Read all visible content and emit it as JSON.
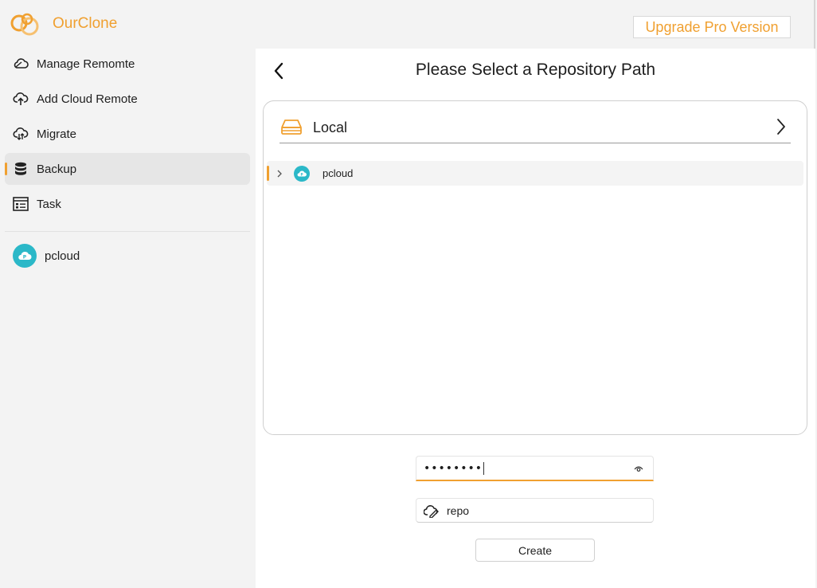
{
  "app": {
    "title": "OurClone",
    "upgrade_label": "Upgrade Pro Version",
    "accent_color": "#f0a030",
    "remote_color": "#2bb8c8"
  },
  "sidebar": {
    "items": [
      {
        "label": "Manage Remomte",
        "icon": "cloud-outline-icon",
        "active": false
      },
      {
        "label": "Add Cloud Remote",
        "icon": "cloud-upload-icon",
        "active": false
      },
      {
        "label": "Migrate",
        "icon": "cloud-sync-icon",
        "active": false
      },
      {
        "label": "Backup",
        "icon": "database-icon",
        "active": true
      },
      {
        "label": "Task",
        "icon": "task-list-icon",
        "active": false
      }
    ],
    "remotes": [
      {
        "label": "pcloud",
        "icon": "pcloud-icon"
      }
    ]
  },
  "main": {
    "title": "Please Select a Repository Path",
    "back_icon": "chevron-left-icon",
    "location": {
      "label": "Local",
      "icon": "drive-icon",
      "chevron": "chevron-right-icon"
    },
    "tree": [
      {
        "label": "pcloud",
        "icon": "pcloud-icon",
        "expanded": false
      }
    ],
    "password": {
      "value": "••••••••",
      "icon": "eye-icon"
    },
    "repo_name": {
      "value": "repo",
      "icon": "cloud-pencil-icon"
    },
    "create_label": "Create"
  }
}
